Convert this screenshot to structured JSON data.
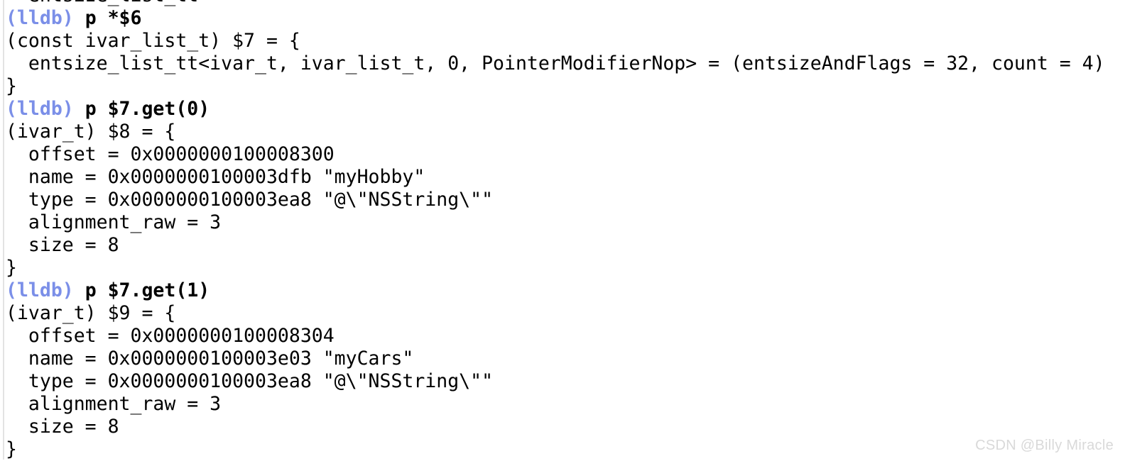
{
  "console": {
    "prompt_label": "(lldb)",
    "colors": {
      "background": "#ffffff",
      "text": "#000000",
      "prompt": "#7b8fe8",
      "gutter": "#e3e3e3",
      "watermark": "#d9d9d9"
    },
    "clipped_top_line": "  entsize_list_tt",
    "lines": [
      {
        "kind": "command",
        "prompt": "(lldb)",
        "command": " p *$6"
      },
      {
        "kind": "output",
        "text": "(const ivar_list_t) $7 = {"
      },
      {
        "kind": "output",
        "text": "  entsize_list_tt<ivar_t, ivar_list_t, 0, PointerModifierNop> = (entsizeAndFlags = 32, count = 4)"
      },
      {
        "kind": "output",
        "text": "}"
      },
      {
        "kind": "command",
        "prompt": "(lldb)",
        "command": " p $7.get(0)"
      },
      {
        "kind": "output",
        "text": "(ivar_t) $8 = {"
      },
      {
        "kind": "output",
        "text": "  offset = 0x0000000100008300"
      },
      {
        "kind": "output",
        "text": "  name = 0x0000000100003dfb \"myHobby\""
      },
      {
        "kind": "output",
        "text": "  type = 0x0000000100003ea8 \"@\\\"NSString\\\"\""
      },
      {
        "kind": "output",
        "text": "  alignment_raw = 3"
      },
      {
        "kind": "output",
        "text": "  size = 8"
      },
      {
        "kind": "output",
        "text": "}"
      },
      {
        "kind": "command",
        "prompt": "(lldb)",
        "command": " p $7.get(1)"
      },
      {
        "kind": "output",
        "text": "(ivar_t) $9 = {"
      },
      {
        "kind": "output",
        "text": "  offset = 0x0000000100008304"
      },
      {
        "kind": "output",
        "text": "  name = 0x0000000100003e03 \"myCars\""
      },
      {
        "kind": "output",
        "text": "  type = 0x0000000100003ea8 \"@\\\"NSString\\\"\""
      },
      {
        "kind": "output",
        "text": "  alignment_raw = 3"
      },
      {
        "kind": "output",
        "text": "  size = 8"
      },
      {
        "kind": "output",
        "text": "}"
      }
    ]
  },
  "watermark": {
    "text": "CSDN @Billy Miracle"
  }
}
